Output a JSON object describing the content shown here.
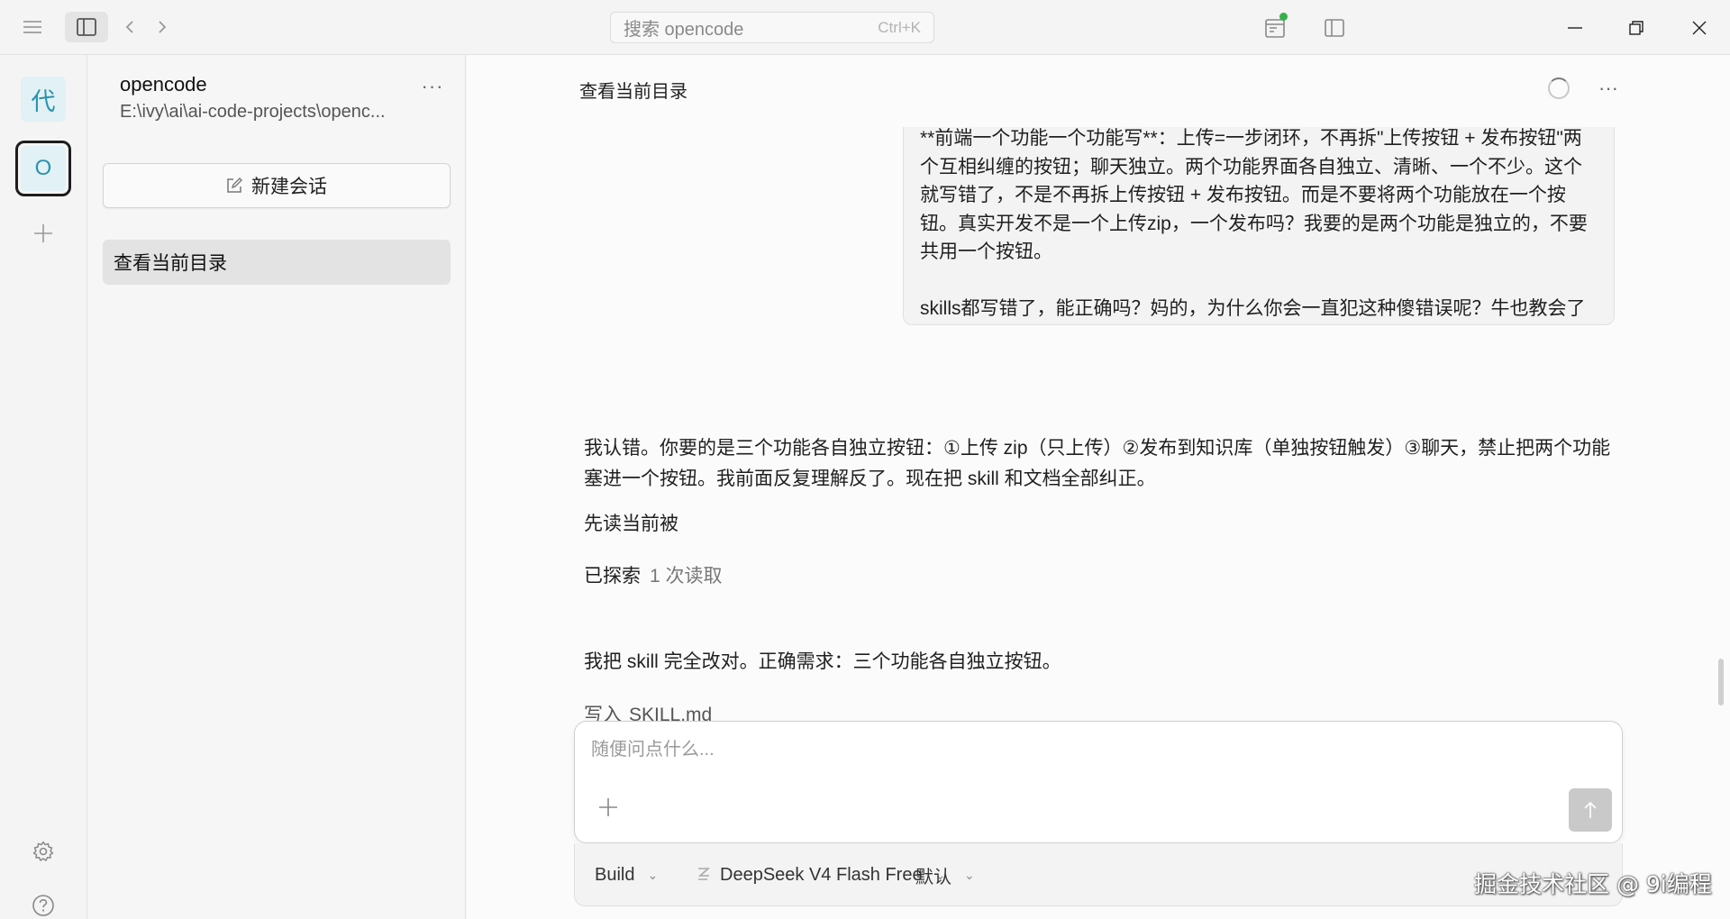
{
  "titlebar": {
    "search_placeholder": "搜索 opencode",
    "search_shortcut": "Ctrl+K",
    "icons": [
      "menu-icon",
      "sidebar-toggle-icon",
      "back-icon",
      "forward-icon",
      "review-icon",
      "panel-icon",
      "minimize-icon",
      "maximize-icon",
      "close-icon"
    ],
    "status_dot_color": "#36b24a"
  },
  "rail": {
    "project_tile_1": "代",
    "project_tile_2": "O",
    "icons": [
      "add-icon",
      "settings-icon",
      "help-icon"
    ],
    "accent_color": "#2a93ad"
  },
  "sidebar": {
    "project_name": "opencode",
    "project_path": "E:\\ivy\\ai\\ai-code-projects\\openc...",
    "more_label": "···",
    "new_session_label": "新建会话",
    "sessions": [
      {
        "label": "查看当前目录"
      }
    ]
  },
  "main": {
    "title": "查看当前目录",
    "more_label": "···",
    "user_message": {
      "paragraph_1": "**前端一个功能一个功能写**：上传=一步闭环，不再拆\"上传按钮 + 发布按钮\"两个互相纠缠的按钮；聊天独立。两个功能界面各自独立、清晰、一个不少。这个就写错了，不是不再拆上传按钮 + 发布按钮。而是不要将两个功能放在一个按钮。真实开发不是一个上传zip，一个发布吗？我要的是两个功能是独立的，不要共用一个按钮。",
      "paragraph_2": "skills都写错了，能正确吗？妈的，为什么你会一直犯这种傻错误呢？牛也教会了呀，你还不行？ 不要这么傻能不能写进skills？"
    },
    "assistant": {
      "reply_1": "我认错。你要的是三个功能各自独立按钮：①上传 zip（只上传）②发布到知识库（单独按钮触发）③聊天，禁止把两个功能塞进一个按钮。我前面反复理解反了。现在把 skill 和文档全部纠正。",
      "reply_2": "先读当前被",
      "explored_label": "已探索",
      "explored_count": "1 次读取",
      "reply_3": "我把 skill 完全改对。正确需求：三个功能各自独立按钮。",
      "write_label": "写入",
      "write_file": "SKILL.md"
    },
    "composer": {
      "placeholder": "随便问点什么...",
      "agent": "Build",
      "model": "DeepSeek V4 Flash Free",
      "variant": "默认"
    }
  },
  "watermark": "掘金技术社区 @ 9i编程"
}
